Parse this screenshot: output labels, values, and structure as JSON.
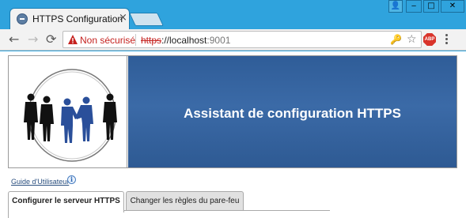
{
  "window": {
    "tab_title": "HTTPS Configuration",
    "tab_close": "×",
    "controls": {
      "user": "👤",
      "minimize": "‒",
      "maximize": "□",
      "close": "✕"
    }
  },
  "toolbar": {
    "back": "←",
    "forward": "→",
    "reload": "⟳",
    "security_label": "Non sécurisé",
    "url_scheme": "https",
    "url_rest": "://localhost",
    "url_port": ":9001",
    "key": "🔑",
    "star": "☆",
    "abp_label": "ABP"
  },
  "banner": {
    "title": "Assistant de configuration HTTPS"
  },
  "help": {
    "guide_link": "Guide d'Utilisateur",
    "info_icon": "i"
  },
  "tabs": [
    {
      "label": "Configurer le serveur HTTPS"
    },
    {
      "label": "Changer les règles du pare-feu"
    }
  ],
  "colors": {
    "chrome_frame": "#2fa3dd",
    "banner_blue": "#2f5d98",
    "insecure_red": "#c5221f"
  }
}
